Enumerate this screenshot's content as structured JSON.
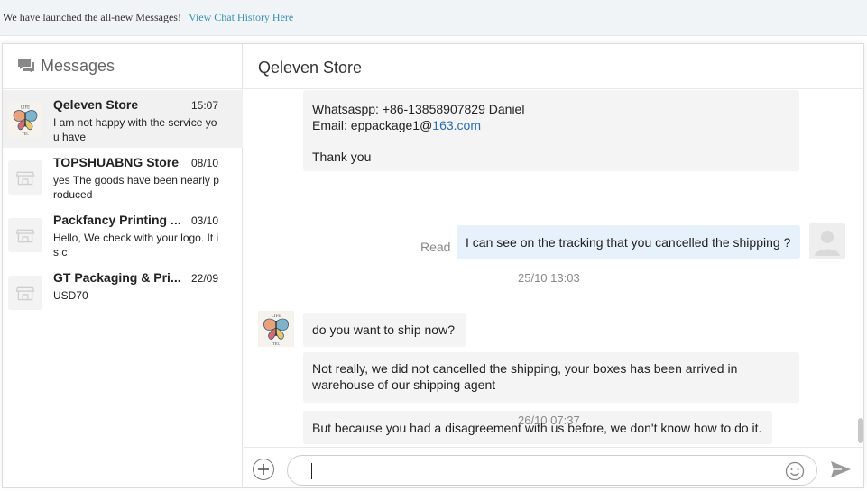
{
  "banner": {
    "text": "We have launched the all-new Messages!",
    "link": "View Chat History Here"
  },
  "sidebar": {
    "title": "Messages",
    "icon": "message-icon",
    "conversations": [
      {
        "name": "Qeleven Store",
        "date": "15:07",
        "preview": "I am not happy with the service yo u have",
        "avatar": "butterfly-logo",
        "active": true
      },
      {
        "name": "TOPSHUABNG Store",
        "date": "08/10",
        "preview": "yes The goods have been nearly produced",
        "avatar": "store-icon"
      },
      {
        "name": "Packfancy Printing ...",
        "date": "03/10",
        "preview": "Hello, We check with your logo. It i s c",
        "avatar": "store-icon"
      },
      {
        "name": "GT Packaging & Pri...",
        "date": "22/09",
        "preview": "USD70",
        "avatar": "store-icon"
      }
    ]
  },
  "chat": {
    "title": "Qeleven Store",
    "msg1": {
      "line1": "Whatsaspp: +86-13858907829 Daniel",
      "email_prefix": "Email: eppackage1@",
      "email_domain": "163.com",
      "line3": "Thank you"
    },
    "read_label": "Read",
    "msg2": "I can see on the tracking that you cancelled the shipping ?",
    "ts1": "25/10 13:03",
    "msg3": "do you want to ship now?",
    "msg4_line1": "Not really, we did not cancelled the shipping, your boxes has been arrived in",
    "msg4_line2": "warehouse of our shipping agent",
    "msg5": "But because you had a disagreement with us before, we don't know how to do it.",
    "ts2": "26/10 07:37"
  },
  "input": {
    "value": "",
    "plus_icon": "plus-icon",
    "emoji_icon": "smiley-icon",
    "send_icon": "send-icon"
  },
  "colors": {
    "link": "#3a8fb0",
    "outgoing_bubble": "#e6f1fb",
    "incoming_bubble": "#f4f4f4"
  }
}
